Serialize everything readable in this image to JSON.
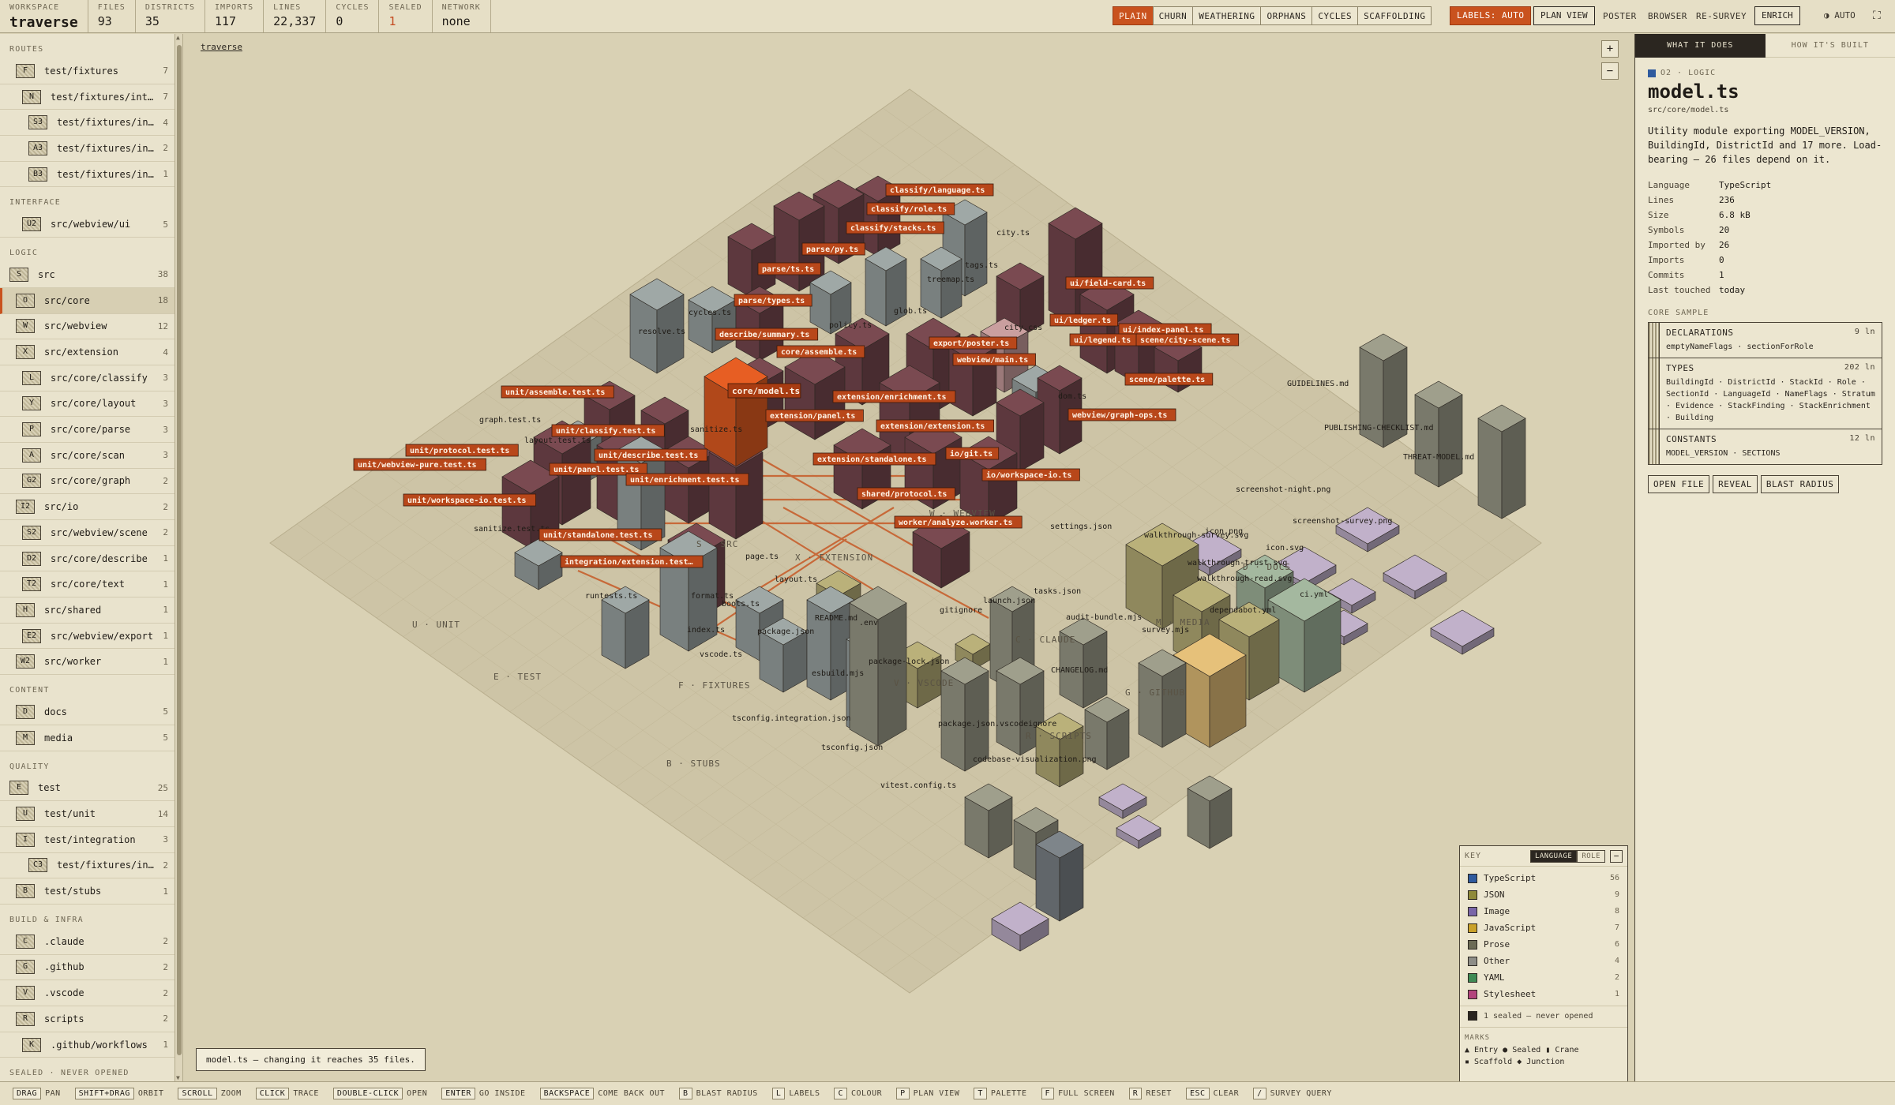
{
  "topbar": {
    "stats": [
      {
        "label": "WORKSPACE",
        "value": "traverse",
        "kind": "workspace"
      },
      {
        "label": "FILES",
        "value": "93"
      },
      {
        "label": "DISTRICTS",
        "value": "35"
      },
      {
        "label": "IMPORTS",
        "value": "117"
      },
      {
        "label": "LINES",
        "value": "22,337"
      },
      {
        "label": "CYCLES",
        "value": "0"
      },
      {
        "label": "SEALED",
        "value": "1",
        "warn": true
      },
      {
        "label": "NETWORK",
        "value": "none"
      }
    ],
    "view_modes": [
      "PLAIN",
      "CHURN",
      "WEATHERING",
      "ORPHANS",
      "CYCLES",
      "SCAFFOLDING"
    ],
    "active_mode": "PLAIN",
    "labels_button": "LABELS: AUTO",
    "plan_view": "PLAN VIEW",
    "links": [
      "POSTER",
      "BROWSER",
      "RE-SURVEY"
    ],
    "enrich": "ENRICH",
    "auto": "AUTO",
    "fullscreen_icon": "fullscreen-icon"
  },
  "sidebar": {
    "groups": [
      {
        "heading": "ROUTES",
        "items": [
          {
            "glyph": "F",
            "label": "test/fixtures",
            "count": "7",
            "indent": 1
          },
          {
            "glyph": "N",
            "label": "test/fixtures/integr…",
            "count": "7",
            "indent": 2
          },
          {
            "glyph": "S3",
            "label": "test/fixtures/inte…",
            "count": "4",
            "indent": 3
          },
          {
            "glyph": "A3",
            "label": "test/fixtures/inte…",
            "count": "2",
            "indent": 3
          },
          {
            "glyph": "B3",
            "label": "test/fixtures/inte…",
            "count": "1",
            "indent": 3
          }
        ]
      },
      {
        "heading": "INTERFACE",
        "items": [
          {
            "glyph": "U2",
            "label": "src/webview/ui",
            "count": "5",
            "indent": 2
          }
        ]
      },
      {
        "heading": "LOGIC",
        "items": [
          {
            "glyph": "S",
            "label": "src",
            "count": "38",
            "indent": 0
          },
          {
            "glyph": "O",
            "label": "src/core",
            "count": "18",
            "indent": 1,
            "selected": true
          },
          {
            "glyph": "W",
            "label": "src/webview",
            "count": "12",
            "indent": 1
          },
          {
            "glyph": "X",
            "label": "src/extension",
            "count": "4",
            "indent": 1
          },
          {
            "glyph": "L",
            "label": "src/core/classify",
            "count": "3",
            "indent": 2
          },
          {
            "glyph": "Y",
            "label": "src/core/layout",
            "count": "3",
            "indent": 2
          },
          {
            "glyph": "P",
            "label": "src/core/parse",
            "count": "3",
            "indent": 2
          },
          {
            "glyph": "A",
            "label": "src/core/scan",
            "count": "3",
            "indent": 2
          },
          {
            "glyph": "G2",
            "label": "src/core/graph",
            "count": "2",
            "indent": 2
          },
          {
            "glyph": "I2",
            "label": "src/io",
            "count": "2",
            "indent": 1
          },
          {
            "glyph": "S2",
            "label": "src/webview/scene",
            "count": "2",
            "indent": 2
          },
          {
            "glyph": "D2",
            "label": "src/core/describe",
            "count": "1",
            "indent": 2
          },
          {
            "glyph": "T2",
            "label": "src/core/text",
            "count": "1",
            "indent": 2
          },
          {
            "glyph": "H",
            "label": "src/shared",
            "count": "1",
            "indent": 1
          },
          {
            "glyph": "E2",
            "label": "src/webview/export",
            "count": "1",
            "indent": 2
          },
          {
            "glyph": "W2",
            "label": "src/worker",
            "count": "1",
            "indent": 1
          }
        ]
      },
      {
        "heading": "CONTENT",
        "items": [
          {
            "glyph": "D",
            "label": "docs",
            "count": "5",
            "indent": 1
          },
          {
            "glyph": "M",
            "label": "media",
            "count": "5",
            "indent": 1
          }
        ]
      },
      {
        "heading": "QUALITY",
        "items": [
          {
            "glyph": "E",
            "label": "test",
            "count": "25",
            "indent": 0
          },
          {
            "glyph": "U",
            "label": "test/unit",
            "count": "14",
            "indent": 1
          },
          {
            "glyph": "I",
            "label": "test/integration",
            "count": "3",
            "indent": 1
          },
          {
            "glyph": "C3",
            "label": "test/fixtures/inte…",
            "count": "2",
            "indent": 3
          },
          {
            "glyph": "B",
            "label": "test/stubs",
            "count": "1",
            "indent": 1
          }
        ]
      },
      {
        "heading": "BUILD & INFRA",
        "items": [
          {
            "glyph": "C",
            "label": ".claude",
            "count": "2",
            "indent": 1
          },
          {
            "glyph": "G",
            "label": ".github",
            "count": "2",
            "indent": 1
          },
          {
            "glyph": "V",
            "label": ".vscode",
            "count": "2",
            "indent": 1
          },
          {
            "glyph": "R",
            "label": "scripts",
            "count": "2",
            "indent": 1
          },
          {
            "glyph": "K",
            "label": ".github/workflows",
            "count": "1",
            "indent": 2
          }
        ]
      },
      {
        "heading": "SEALED · NEVER OPENED",
        "items": []
      }
    ]
  },
  "canvas": {
    "breadcrumb": "traverse",
    "zoom_in": "+",
    "zoom_out": "−",
    "status": "model.ts — changing it reaches 35 files.",
    "districts": [
      {
        "label": "S · SRC"
      },
      {
        "label": "X · EXTENSION"
      },
      {
        "label": "W · WEBVIEW"
      },
      {
        "label": "U · UNIT"
      },
      {
        "label": "E · TEST"
      },
      {
        "label": "F · FIXTURES"
      },
      {
        "label": "B · STUBS"
      },
      {
        "label": "V · VSCODE"
      },
      {
        "label": "C · CLAUDE"
      },
      {
        "label": "M · MEDIA"
      },
      {
        "label": "D · DOCS"
      },
      {
        "label": "G · GITHUB"
      },
      {
        "label": "R · SCRIPTS"
      }
    ],
    "tags": [
      "classify/language.ts",
      "classify/role.ts",
      "classify/stacks.ts",
      "parse/py.ts",
      "parse/ts.ts",
      "parse/types.ts",
      "describe/summary.ts",
      "core/assemble.ts",
      "core/model.ts",
      "export/poster.ts",
      "webview/main.ts",
      "ui/field-card.ts",
      "ui/ledger.ts",
      "ui/index-panel.ts",
      "ui/legend.ts",
      "scene/city-scene.ts",
      "scene/palette.ts",
      "webview/graph-ops.ts",
      "extension/enrichment.ts",
      "extension/panel.ts",
      "extension/extension.ts",
      "extension/standalone.ts",
      "io/git.ts",
      "io/workspace-io.ts",
      "shared/protocol.ts",
      "worker/analyze.worker.ts",
      "unit/assemble.test.ts",
      "unit/classify.test.ts",
      "unit/protocol.test.ts",
      "unit/webview-pure.test.ts",
      "unit/describe.test.ts",
      "unit/panel.test.ts",
      "unit/enrichment.test.ts",
      "unit/workspace-io.test.ts",
      "unit/standalone.test.ts",
      "integration/extension.test…"
    ],
    "plain_labels": [
      "city.ts",
      "tags.ts",
      "treemap.ts",
      "glob.ts",
      "cycles.ts",
      "resolve.ts",
      "policy.ts",
      "city.css",
      "dom.ts",
      "graph.test.ts",
      "layout.test.ts",
      "sanitize.ts",
      "sanitize.test.ts",
      "parse.test.ts",
      "runtests.ts",
      "page.ts",
      "layout.ts",
      "format.ts",
      "boots.ts",
      "index.ts",
      "package.json",
      "README.md",
      ".env",
      "vscode.ts",
      "esbuild.mjs",
      "package-lock.json",
      "tsconfig.integration.json",
      "tsconfig.json",
      "vitest.config.ts",
      "package.json",
      ".vscodeignore",
      "gitignore",
      "launch.json",
      "settings.json",
      "tasks.json",
      "audit-bundle.mjs",
      "survey.mjs",
      "CHANGELOG.md",
      "codebase-visualization.png",
      "GUIDELINES.md",
      "PUBLISHING-CHECKLIST.md",
      "THREAT-MODEL.md",
      "screenshot-night.png",
      "screenshot-survey.png",
      "icon.png",
      "icon.svg",
      "walkthrough-survey.svg",
      "walkthrough-trust.svg",
      "walkthrough-read.svg",
      "ci.yml",
      "dependabot.yml"
    ]
  },
  "key": {
    "title": "KEY",
    "tab_language": "LANGUAGE",
    "tab_role": "ROLE",
    "minimize": "−",
    "rows": [
      {
        "label": "TypeScript",
        "count": "56",
        "color": "#2f5a9e"
      },
      {
        "label": "JSON",
        "count": "9",
        "color": "#8f8a3a"
      },
      {
        "label": "Image",
        "count": "8",
        "color": "#7a66a8"
      },
      {
        "label": "JavaScript",
        "count": "7",
        "color": "#c9a12a"
      },
      {
        "label": "Prose",
        "count": "6",
        "color": "#6b6a55"
      },
      {
        "label": "Other",
        "count": "4",
        "color": "#8d8d88"
      },
      {
        "label": "YAML",
        "count": "2",
        "color": "#3f8a55"
      },
      {
        "label": "Stylesheet",
        "count": "1",
        "color": "#b3447d"
      }
    ],
    "sealed_note": "1 sealed — never opened",
    "marks_heading": "MARKS",
    "marks_line1": "▲ Entry   ● Sealed   ▮ Crane",
    "marks_line2": "▪ Scaffold   ◆ Junction"
  },
  "inspector": {
    "tab_active": "WHAT IT DOES",
    "tab_inactive": "HOW IT'S BUILT",
    "tag": "O2 · LOGIC",
    "title": "model.ts",
    "path": "src/core/model.ts",
    "description": "Utility module exporting MODEL_VERSION, BuildingId, DistrictId and 17 more. Load-bearing — 26 files depend on it.",
    "meta": [
      {
        "k": "Language",
        "v": "TypeScript"
      },
      {
        "k": "Lines",
        "v": "236"
      },
      {
        "k": "Size",
        "v": "6.8 kB"
      },
      {
        "k": "Symbols",
        "v": "20"
      },
      {
        "k": "Imported by",
        "v": "26"
      },
      {
        "k": "Imports",
        "v": "0"
      },
      {
        "k": "Commits",
        "v": "1"
      },
      {
        "k": "Last touched",
        "v": "today"
      }
    ],
    "core_heading": "CORE SAMPLE",
    "core": [
      {
        "title": "DECLARATIONS",
        "lines": "9 ln",
        "items": "emptyNameFlags · sectionForRole"
      },
      {
        "title": "TYPES",
        "lines": "202 ln",
        "items": "BuildingId · DistrictId · StackId · Role · SectionId · LanguageId · NameFlags · Stratum · Evidence · StackFinding · StackEnrichment · Building"
      },
      {
        "title": "CONSTANTS",
        "lines": "12 ln",
        "items": "MODEL_VERSION · SECTIONS"
      }
    ],
    "actions": [
      "OPEN FILE",
      "REVEAL",
      "BLAST RADIUS"
    ]
  },
  "bottombar": {
    "hints": [
      {
        "key": "DRAG",
        "text": "PAN"
      },
      {
        "key": "SHIFT+DRAG",
        "text": "ORBIT"
      },
      {
        "key": "SCROLL",
        "text": "ZOOM"
      },
      {
        "key": "CLICK",
        "text": "TRACE"
      },
      {
        "key": "DOUBLE-CLICK",
        "text": "OPEN"
      },
      {
        "key": "ENTER",
        "text": "GO INSIDE"
      },
      {
        "key": "BACKSPACE",
        "text": "COME BACK OUT"
      },
      {
        "key": "B",
        "text": "BLAST RADIUS"
      },
      {
        "key": "L",
        "text": "LABELS"
      },
      {
        "key": "C",
        "text": "COLOUR"
      },
      {
        "key": "P",
        "text": "PLAN VIEW"
      },
      {
        "key": "T",
        "text": "PALETTE"
      },
      {
        "key": "F",
        "text": "FULL SCREEN"
      },
      {
        "key": "R",
        "text": "RESET"
      },
      {
        "key": "ESC",
        "text": "CLEAR"
      },
      {
        "key": "/",
        "text": "SURVEY QUERY"
      }
    ]
  }
}
